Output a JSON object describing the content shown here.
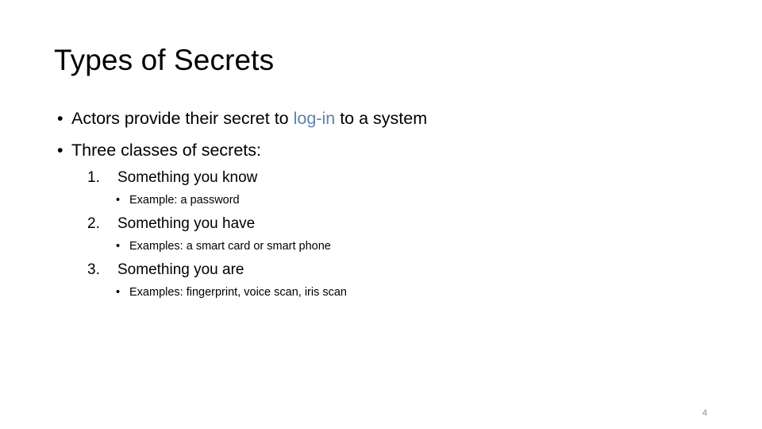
{
  "slide": {
    "title": "Types of Secrets",
    "page_number": "4",
    "accent_color": "#5e83a8",
    "text_color": "#000000",
    "background_color": "#ffffff",
    "bullet_glyph": "•",
    "bullets": [
      {
        "marker": "•",
        "text_before": "Actors provide their secret to ",
        "accent": "log-in",
        "text_after": " to a system"
      },
      {
        "marker": "•",
        "text": "Three classes of secrets:"
      }
    ],
    "numbered_items": [
      {
        "marker": "1.",
        "label": "Something you know",
        "sub_marker": "•",
        "sub_label": "Example: a password"
      },
      {
        "marker": "2.",
        "label": "Something you have",
        "sub_marker": "•",
        "sub_label": "Examples: a smart card or smart phone"
      },
      {
        "marker": "3.",
        "label": "Something you are",
        "sub_marker": "•",
        "sub_label": "Examples: fingerprint, voice scan, iris scan"
      }
    ]
  }
}
